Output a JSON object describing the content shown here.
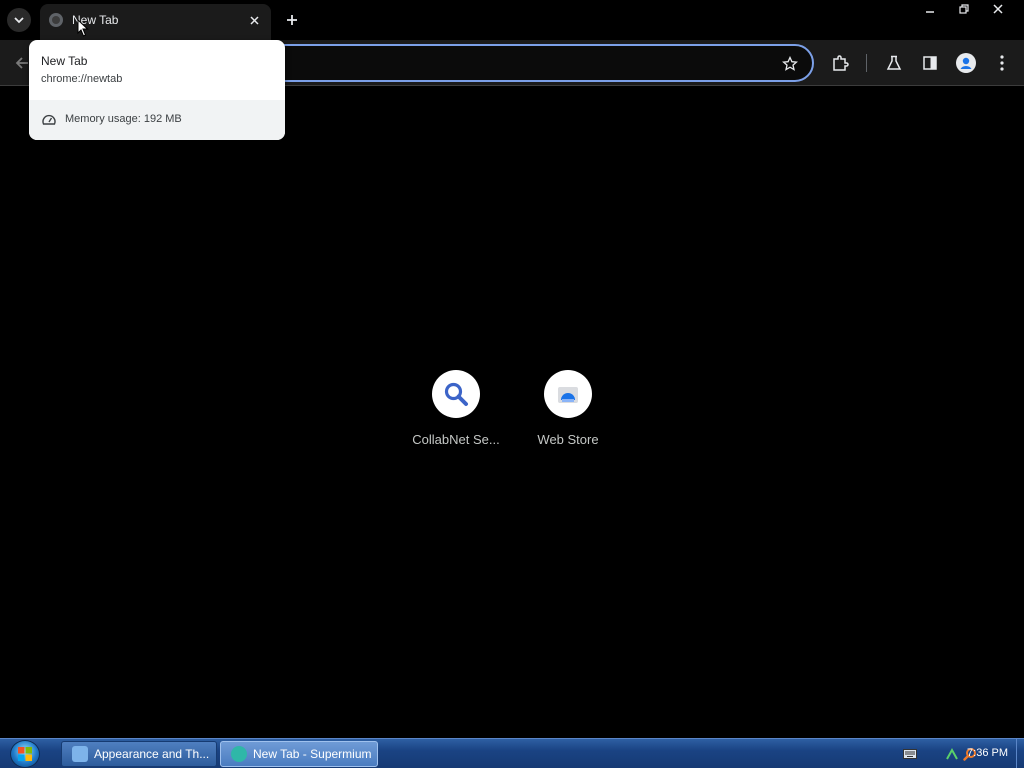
{
  "browser": {
    "tab": {
      "title": "New Tab"
    },
    "hover_card": {
      "title": "New Tab",
      "url": "chrome://newtab",
      "memory": "Memory usage: 192 MB"
    },
    "omnibox": {
      "value": ""
    }
  },
  "shortcuts": [
    {
      "label": "CollabNet Se...",
      "icon": "search-icon"
    },
    {
      "label": "Web Store",
      "icon": "web-store-icon"
    }
  ],
  "taskbar": {
    "buttons": [
      {
        "label": "Appearance and Th...",
        "active": false
      },
      {
        "label": "New Tab - Supermium",
        "active": true
      }
    ],
    "clock": "7:36 PM"
  },
  "colors": {
    "accent": "#7ca0e8",
    "search_icon": "#3c64c8",
    "page_bg": "#000000",
    "taskbar": "#1a4383"
  }
}
